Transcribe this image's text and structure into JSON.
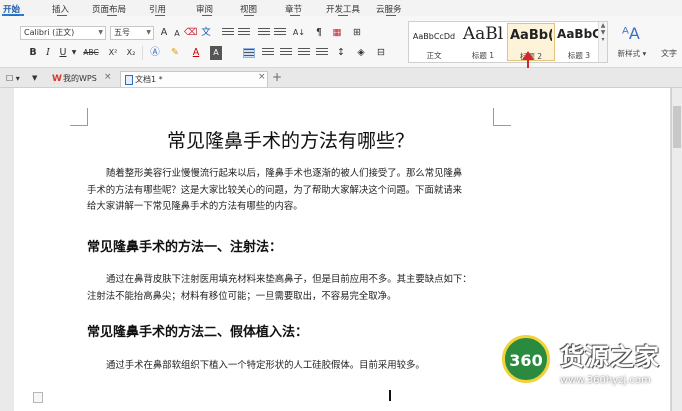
{
  "ribbon_tabs": [
    {
      "label": "开始",
      "key": "H",
      "active": true
    },
    {
      "label": "插入",
      "key": "N"
    },
    {
      "label": "页面布局",
      "key": "P"
    },
    {
      "label": "引用",
      "key": "S"
    },
    {
      "label": "审阅",
      "key": "R"
    },
    {
      "label": "视图",
      "key": "W"
    },
    {
      "label": "章节",
      "key": "Z"
    },
    {
      "label": "开发工具",
      "key": "L"
    },
    {
      "label": "云服务",
      "key": "K"
    }
  ],
  "font": {
    "name": "Calibri (正文)",
    "size": "五号"
  },
  "format_buttons": {
    "bold": "B",
    "italic": "I",
    "underline": "U",
    "strike": "ABC",
    "super": "X²",
    "sub": "X₂",
    "grow": "A",
    "shrink": "A"
  },
  "styles": [
    {
      "sample": "AaBbCcDd",
      "name": "正文"
    },
    {
      "sample": "AaBl",
      "name": "标题 1"
    },
    {
      "sample": "AaBb(",
      "name": "标题 2"
    },
    {
      "sample": "AaBbC",
      "name": "标题 3"
    }
  ],
  "new_style_label": "新样式",
  "text_tools_label": "文字",
  "doc_tabs": [
    {
      "label": "我的WPS"
    },
    {
      "label": "文档1 *"
    }
  ],
  "document": {
    "title": "常见隆鼻手术的方法有哪些？",
    "intro": [
      "随着整形美容行业慢慢流行起来以后，隆鼻手术也逐渐的被人们接受了。那么常见隆鼻",
      "手术的方法有哪些呢？这是大家比较关心的问题，为了帮助大家解决这个问题。下面就请来",
      "给大家讲解一下常见隆鼻手术的方法有哪些的内容。"
    ],
    "h1": "常见隆鼻手术的方法一、注射法：",
    "p1": [
      "通过在鼻背皮肤下注射医用填充材料来垫高鼻子，但是目前应用不多。其主要缺点如下：",
      "注射法不能抬高鼻尖；材料有移位可能；一旦需要取出，不容易完全取净。"
    ],
    "h2": "常见隆鼻手术的方法二、假体植入法：",
    "p2": [
      "通过手术在鼻部软组织下植入一个特定形状的人工硅胶假体。目前采用较多。"
    ]
  },
  "watermark": {
    "badge": "360",
    "text": "货源之家",
    "url": "www.360hyzj.com"
  },
  "colors": {
    "accent": "#2b79d0",
    "arrow": "#d42828",
    "watermark_green": "#2a8a3e"
  }
}
